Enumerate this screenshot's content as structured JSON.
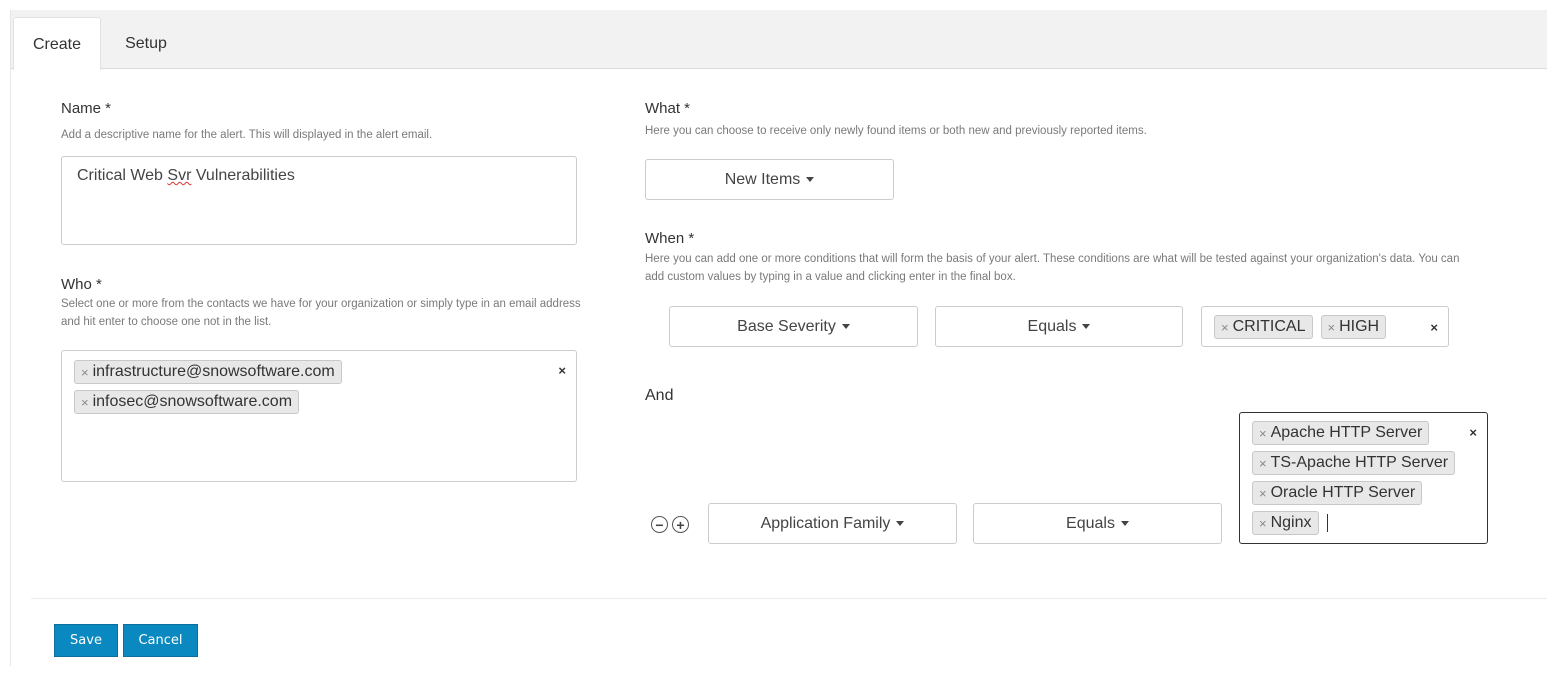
{
  "tabs": [
    {
      "label": "Create",
      "active": true
    },
    {
      "label": "Setup",
      "active": false
    }
  ],
  "name_field": {
    "label": "Name *",
    "help": "Add a descriptive name for the alert. This will displayed in the alert email.",
    "value_before": "Critical Web ",
    "value_misspelled": "Svr",
    "value_after": " Vulnerabilities"
  },
  "who_field": {
    "label": "Who *",
    "help": "Select one or more from the contacts we have for your organization or simply type in an email address and hit enter to choose one not in the list.",
    "chips": [
      "infrastructure@snowsoftware.com",
      "infosec@snowsoftware.com"
    ],
    "clear_icon": "×"
  },
  "what_field": {
    "label": "What *",
    "help": "Here you can choose to receive only newly found items or both new and previously reported items.",
    "selected": "New Items"
  },
  "when_field": {
    "label": "When *",
    "help": "Here you can add one or more conditions that will form the basis of your alert. These conditions are what will be tested against your organization's data. You can add custom values by typing in a value and clicking enter in the final box.",
    "conditions": [
      {
        "field": "Base Severity",
        "operator": "Equals",
        "values": [
          "CRITICAL",
          "HIGH"
        ]
      },
      {
        "field": "Application Family",
        "operator": "Equals",
        "values": [
          "Apache HTTP Server",
          "TS-Apache HTTP Server",
          "Oracle HTTP Server",
          "Nginx"
        ]
      }
    ],
    "joiner": "And",
    "remove_icon": "−",
    "add_icon": "+",
    "chip_remove": "×",
    "clear_icon": "×"
  },
  "actions": {
    "save": "Save",
    "cancel": "Cancel"
  },
  "colors": {
    "primary_button": "#0a89c1",
    "tabbar_bg": "#f2f2f2"
  }
}
